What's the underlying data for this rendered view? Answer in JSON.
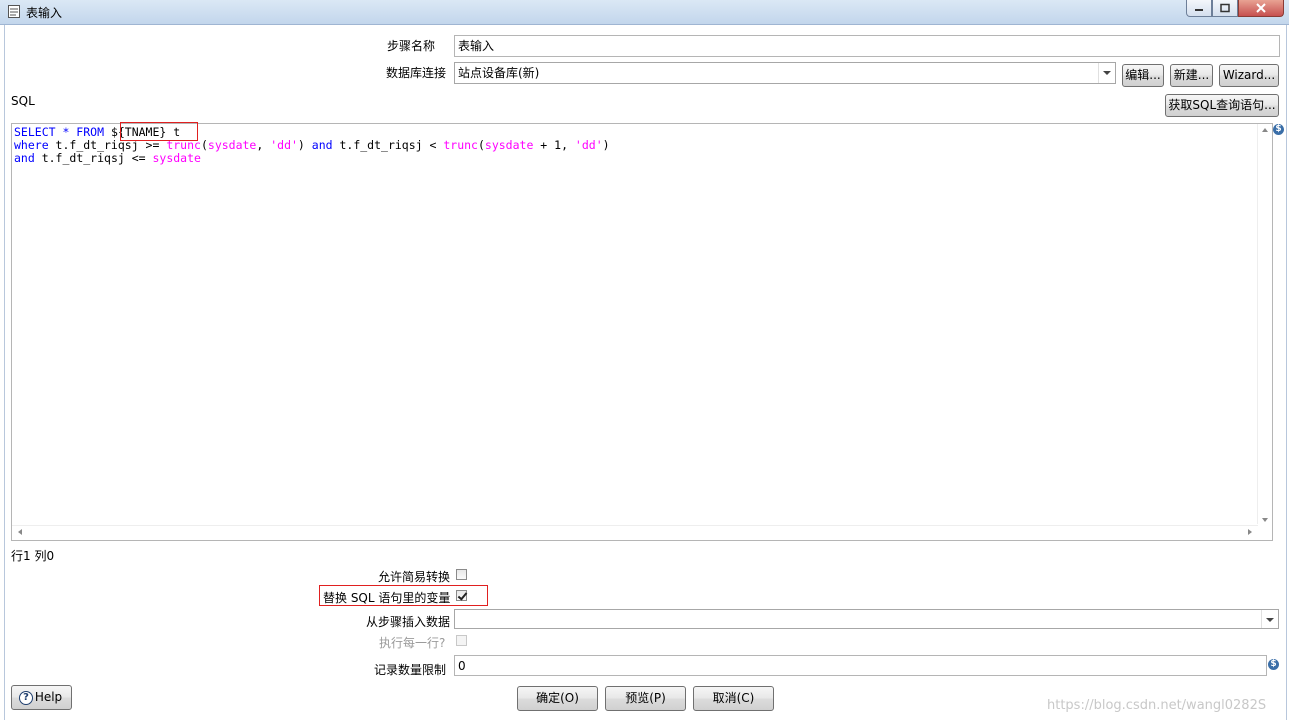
{
  "window": {
    "title": "表输入",
    "icon": "table-input-icon",
    "controls": [
      "minimize-icon",
      "maximize-icon",
      "close-icon"
    ]
  },
  "form": {
    "step_name_label": "步骤名称",
    "step_name_value": "表输入",
    "db_conn_label": "数据库连接",
    "db_conn_value": "站点设备库(新)",
    "edit_button": "编辑...",
    "new_button": "新建...",
    "wizard_button": "Wizard...",
    "sql_label": "SQL",
    "get_sql_button": "获取SQL查询语句...",
    "position": "行1 列0"
  },
  "sql": {
    "line1_kw": "SELECT * FROM ",
    "line1_var": "${TNAME}",
    "line1_rest": " t",
    "line2_a": "where",
    "line2_b": " t.f_dt_riqsj >= ",
    "line2_c": "trunc",
    "line2_d": "(",
    "line2_e": "sysdate",
    "line2_f": ", ",
    "line2_g": "'dd'",
    "line2_h": ") ",
    "line2_i": "and",
    "line2_j": " t.f_dt_riqsj < ",
    "line2_k": "trunc",
    "line2_l": "(",
    "line2_m": "sysdate",
    "line2_n": " + 1, ",
    "line2_o": "'dd'",
    "line2_p": ")",
    "line3_a": "and",
    "line3_b": " t.f_dt_riqsj <= ",
    "line3_c": "sysdate"
  },
  "options": {
    "lazy_conversion_label": "允许简易转换",
    "lazy_conversion_checked": false,
    "replace_vars_label": "替换 SQL 语句里的变量",
    "replace_vars_checked": true,
    "insert_from_step_label": "从步骤插入数据",
    "insert_from_step_value": "",
    "execute_each_row_label": "执行每一行?",
    "execute_each_row_checked": false,
    "limit_label": "记录数量限制",
    "limit_value": "0"
  },
  "footer": {
    "help_button": "Help",
    "ok_button": "确定(O)",
    "preview_button": "预览(P)",
    "cancel_button": "取消(C)"
  },
  "watermark": "https://blog.csdn.net/wangl0282S",
  "colors": {
    "keyword": "#0000ff",
    "function": "#ff00ff",
    "highlight_box": "#e02020"
  }
}
